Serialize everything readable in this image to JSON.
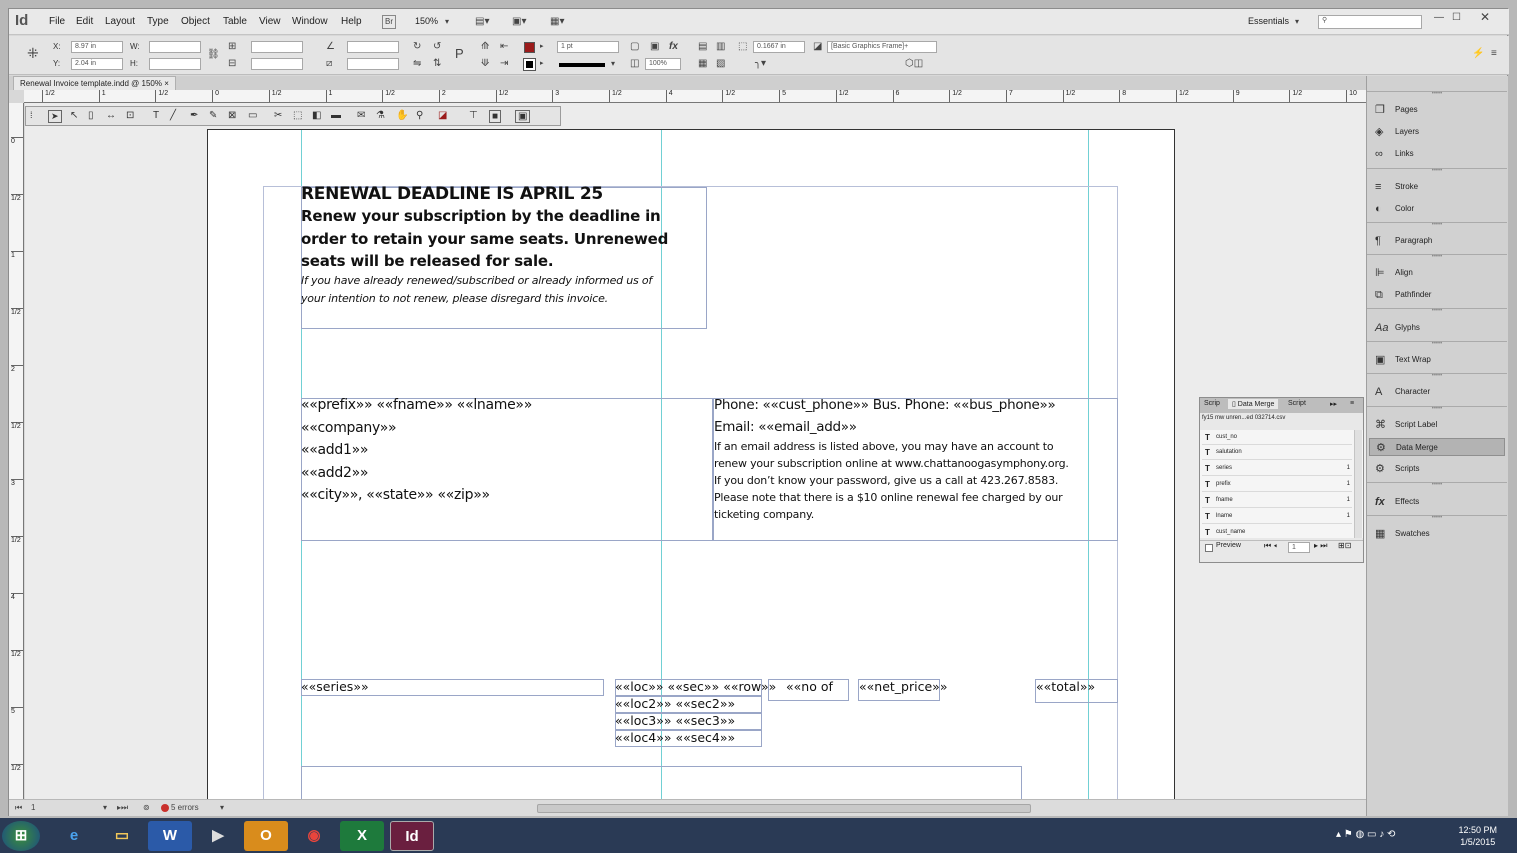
{
  "menubar": {
    "logo": "Id",
    "items": [
      "File",
      "Edit",
      "Layout",
      "Type",
      "Object",
      "Table",
      "View",
      "Window",
      "Help"
    ],
    "zoom": "150%",
    "workspace": "Essentials",
    "search_placeholder": ""
  },
  "control": {
    "x_label": "X:",
    "x_value": "8.97 in",
    "y_label": "Y:",
    "y_value": "2.04 in",
    "w_label": "W:",
    "h_label": "H:",
    "stroke_weight": "1 pt",
    "opacity": "100%",
    "offset_value": "0.1667 in",
    "object_style": "[Basic Graphics Frame]+"
  },
  "document_tab": "Renewal Invoice template.indd @ 150%",
  "ruler": {
    "h_marks": [
      "1/2",
      "1",
      "1/2",
      "0",
      "1/2",
      "1",
      "1/2",
      "2",
      "1/2",
      "3",
      "1/2",
      "4",
      "1/2",
      "5",
      "1/2",
      "6",
      "1/2",
      "7",
      "1/2",
      "8",
      "1/2",
      "9",
      "1/2",
      "10"
    ],
    "v_marks": [
      "0",
      "1/2",
      "1",
      "1/2",
      "2",
      "1/2",
      "3",
      "1/2",
      "4",
      "1/2",
      "5",
      "1/2"
    ]
  },
  "document": {
    "headline": "RENEWAL DEADLINE IS APRIL 25",
    "sub_lines": [
      "Renew your subscription by the deadline in",
      "order to retain your same seats. Unrenewed",
      "seats will be released for sale."
    ],
    "italic_lines": [
      "If you have already renewed/subscribed or already informed us of",
      "your intention to not renew, please disregard this invoice."
    ],
    "address_lines": [
      "««prefix»» ««fname»» ««lname»»",
      "««company»»",
      "««add1»»",
      "««add2»»",
      "««city»», ««state»»   ««zip»»"
    ],
    "phone_line": "Phone: ««cust_phone»»  Bus. Phone: ««bus_phone»»",
    "email_line": "Email: ««email_add»»",
    "info_lines": [
      "If an email address is listed above, you may have an account to",
      "renew your subscription online at www.chattanoogasymphony.org.",
      "If you don’t know your password, give us a call at 423.267.8583.",
      "Please note that there is a $10 online renewal fee charged by our",
      "ticketing company."
    ],
    "series": "««series»»",
    "loc_rows": [
      "««loc»»  ««sec»»  ««row»»",
      "««loc2»»  ««sec2»»",
      "««loc3»»  ««sec3»»",
      "««loc4»»  ««sec4»»"
    ],
    "no_of": "««no of",
    "net_price": "««net_price»»",
    "total": "««total»»"
  },
  "statusbar": {
    "page": "1",
    "errors": "5 errors"
  },
  "right_panel": {
    "items": [
      "Pages",
      "Layers",
      "Links",
      "Stroke",
      "Color",
      "Paragraph",
      "Align",
      "Pathfinder",
      "Glyphs",
      "Text Wrap",
      "Character",
      "Script Label",
      "Data Merge",
      "Scripts",
      "Effects",
      "Swatches"
    ]
  },
  "data_merge": {
    "tabs": [
      "Scrip",
      "Data Merge",
      "Script"
    ],
    "source_file": "fy15 mw unren...ed 032714.csv",
    "fields": [
      {
        "name": "cust_no",
        "count": ""
      },
      {
        "name": "salutation",
        "count": ""
      },
      {
        "name": "series",
        "count": "1"
      },
      {
        "name": "prefix",
        "count": "1"
      },
      {
        "name": "fname",
        "count": "1"
      },
      {
        "name": "lname",
        "count": "1"
      },
      {
        "name": "cust_name",
        "count": ""
      }
    ],
    "preview_label": "Preview",
    "record": "1"
  },
  "taskbar": {
    "time": "12:50 PM",
    "date": "1/5/2015"
  },
  "colors": {
    "fill_swatch": "#9b1b1b",
    "taskbar": "#2a3a55",
    "guides": "#71d0d4"
  }
}
